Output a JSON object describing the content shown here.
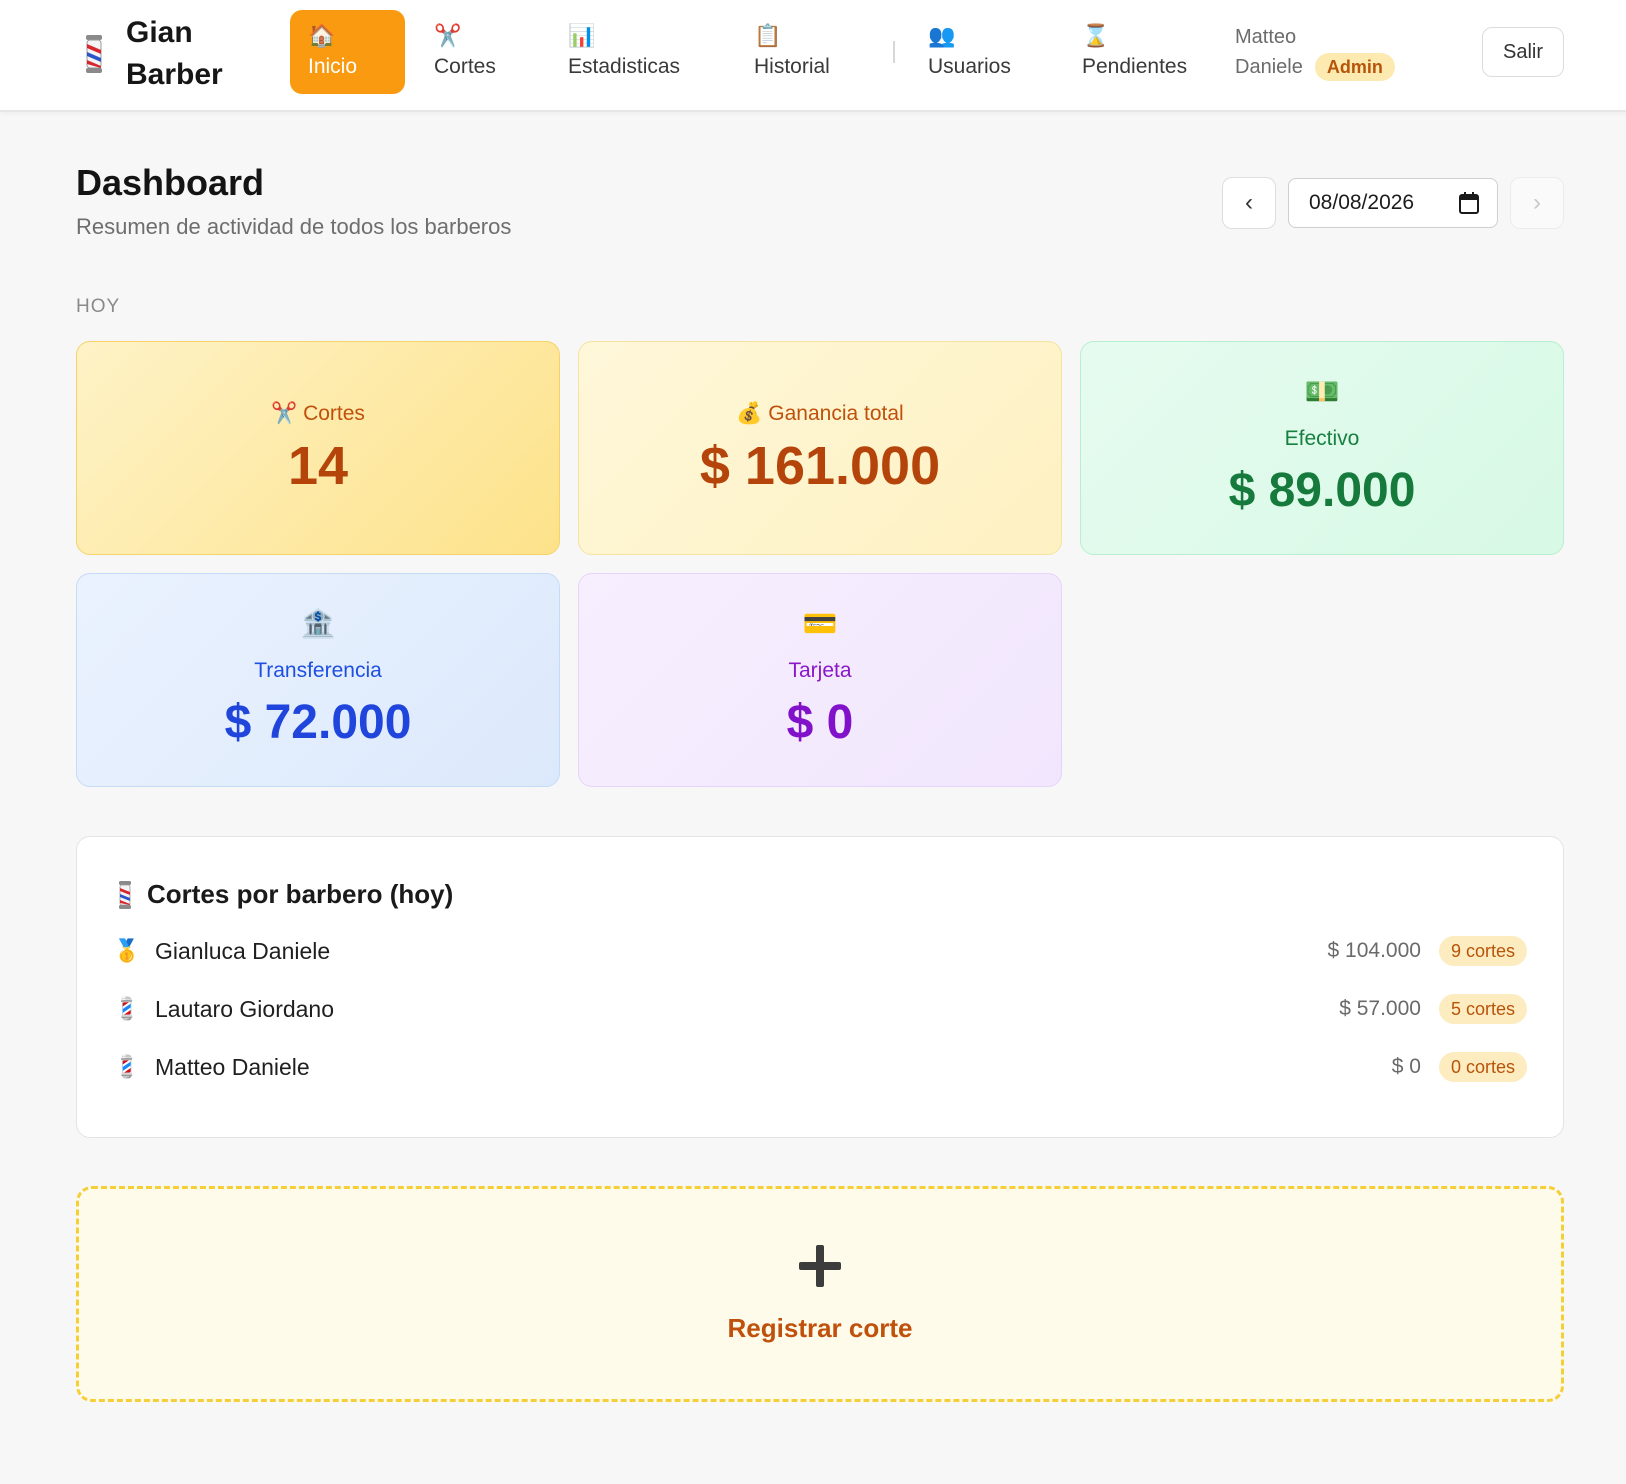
{
  "brand": {
    "name_line1": "Gian",
    "name_line2": "Barber",
    "icon": "barber-pole-icon"
  },
  "nav": {
    "items": [
      {
        "icon": "🏠",
        "icon_name": "home-icon",
        "label": "Inicio",
        "active": true
      },
      {
        "icon": "✂️",
        "icon_name": "scissors-icon",
        "label": "Cortes"
      },
      {
        "icon": "📊",
        "icon_name": "bar-chart-icon",
        "label": "Estadisticas"
      },
      {
        "icon": "📋",
        "icon_name": "clipboard-icon",
        "label": "Historial"
      },
      {
        "icon": "👥",
        "icon_name": "users-icon",
        "label": "Usuarios"
      },
      {
        "icon": "⌛",
        "icon_name": "hourglass-icon",
        "label": "Pendientes"
      }
    ]
  },
  "user": {
    "first_name": "Matteo",
    "last_name": "Daniele",
    "role": "Admin"
  },
  "logout_label": "Salir",
  "page": {
    "title": "Dashboard",
    "subtitle": "Resumen de actividad de todos los barberos",
    "date_value": "08/08/2026",
    "prev_label": "‹",
    "next_label": "›",
    "section_label": "HOY"
  },
  "stats": {
    "cortes": {
      "icon": "✂️",
      "label": "Cortes",
      "value": "14"
    },
    "ganancia": {
      "icon": "💰",
      "label": "Ganancia total",
      "value": "$ 161.000"
    },
    "efectivo": {
      "icon": "💵",
      "label": "Efectivo",
      "value": "$ 89.000"
    },
    "transferencia": {
      "icon": "🏦",
      "label": "Transferencia",
      "value": "$ 72.000"
    },
    "tarjeta": {
      "icon": "💳",
      "label": "Tarjeta",
      "value": "$ 0"
    }
  },
  "barbers": {
    "title": "Cortes por barbero (hoy)",
    "rows": [
      {
        "icon": "🥇",
        "icon_name": "gold-medal-icon",
        "name": "Gianluca Daniele",
        "amount": "$ 104.000",
        "count": "9 cortes"
      },
      {
        "icon": "💈",
        "icon_name": "barber-pole-icon",
        "name": "Lautaro Giordano",
        "amount": "$ 57.000",
        "count": "5 cortes"
      },
      {
        "icon": "💈",
        "icon_name": "barber-pole-icon",
        "name": "Matteo Daniele",
        "amount": "$ 0",
        "count": "0 cortes"
      }
    ]
  },
  "register": {
    "label": "Registrar corte"
  },
  "colors": {
    "accent": "#f99a10",
    "brand_orange": "#c0510c"
  }
}
